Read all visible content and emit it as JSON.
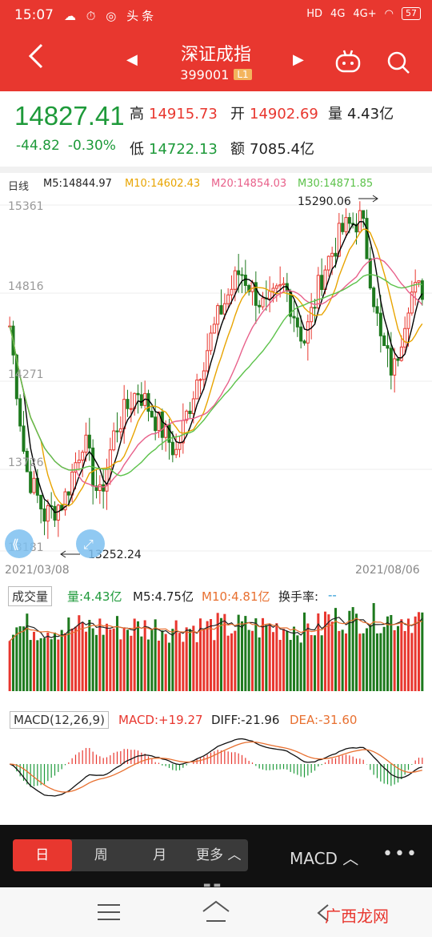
{
  "status_bar": {
    "time": "15:07",
    "left_icons_text": "☁ ⏱ ◎ 头条",
    "hd": "HD",
    "net1": "4G",
    "net2": "4G+",
    "battery": "57"
  },
  "nav": {
    "title": "深证成指",
    "code": "399001",
    "level": "L1"
  },
  "quote": {
    "price": "14827.41",
    "change": "-44.82",
    "change_pct": "-0.30%",
    "high_label": "高",
    "high": "14915.73",
    "open_label": "开",
    "open": "14902.69",
    "vol_label": "量",
    "vol": "4.43亿",
    "low_label": "低",
    "low": "14722.13",
    "amt_label": "额",
    "amt": "7085.4亿"
  },
  "kline": {
    "period_label": "日线",
    "ma5": "M5:14844.97",
    "ma10": "M10:14602.43",
    "ma20": "M20:14854.03",
    "ma30": "M30:14871.85",
    "y_ticks": [
      "15361",
      "14816",
      "14271",
      "13726",
      "13181"
    ],
    "max_label": "15290.06",
    "min_label": "13252.24",
    "start_date": "2021/03/08",
    "end_date": "2021/08/06",
    "colors": {
      "up": "#e8372f",
      "down": "#1e7a1e",
      "ma5": "#000000",
      "ma10": "#e8a400",
      "ma20": "#e8608a",
      "ma30": "#5cc24a"
    }
  },
  "volume": {
    "title": "成交量",
    "vol": "量:4.43亿",
    "m5": "M5:4.75亿",
    "m10": "M10:4.81亿",
    "turnover_label": "换手率:",
    "turnover": "--"
  },
  "macd": {
    "title": "MACD(12,26,9)",
    "macd": "MACD:+19.27",
    "diff": "DIFF:-21.96",
    "dea": "DEA:-31.60"
  },
  "toolbar": {
    "tabs": [
      "日",
      "周",
      "月",
      "更多 ︿"
    ],
    "active_tab": 0,
    "indicator": "MACD ︿",
    "more": "•••"
  },
  "watermark": "广西龙网"
}
